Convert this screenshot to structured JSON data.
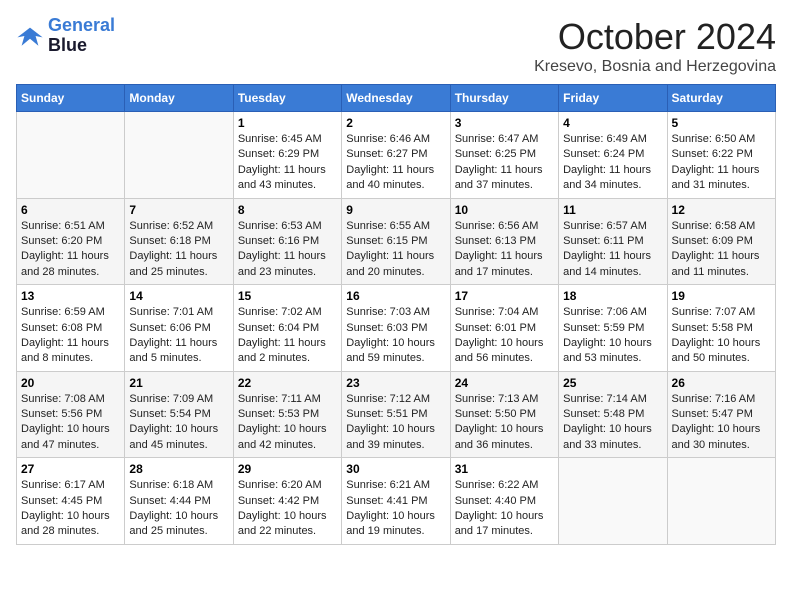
{
  "logo": {
    "line1": "General",
    "line2": "Blue"
  },
  "title": "October 2024",
  "location": "Kresevo, Bosnia and Herzegovina",
  "days_of_week": [
    "Sunday",
    "Monday",
    "Tuesday",
    "Wednesday",
    "Thursday",
    "Friday",
    "Saturday"
  ],
  "weeks": [
    [
      {
        "day": "",
        "info": ""
      },
      {
        "day": "",
        "info": ""
      },
      {
        "day": "1",
        "info": "Sunrise: 6:45 AM\nSunset: 6:29 PM\nDaylight: 11 hours and 43 minutes."
      },
      {
        "day": "2",
        "info": "Sunrise: 6:46 AM\nSunset: 6:27 PM\nDaylight: 11 hours and 40 minutes."
      },
      {
        "day": "3",
        "info": "Sunrise: 6:47 AM\nSunset: 6:25 PM\nDaylight: 11 hours and 37 minutes."
      },
      {
        "day": "4",
        "info": "Sunrise: 6:49 AM\nSunset: 6:24 PM\nDaylight: 11 hours and 34 minutes."
      },
      {
        "day": "5",
        "info": "Sunrise: 6:50 AM\nSunset: 6:22 PM\nDaylight: 11 hours and 31 minutes."
      }
    ],
    [
      {
        "day": "6",
        "info": "Sunrise: 6:51 AM\nSunset: 6:20 PM\nDaylight: 11 hours and 28 minutes."
      },
      {
        "day": "7",
        "info": "Sunrise: 6:52 AM\nSunset: 6:18 PM\nDaylight: 11 hours and 25 minutes."
      },
      {
        "day": "8",
        "info": "Sunrise: 6:53 AM\nSunset: 6:16 PM\nDaylight: 11 hours and 23 minutes."
      },
      {
        "day": "9",
        "info": "Sunrise: 6:55 AM\nSunset: 6:15 PM\nDaylight: 11 hours and 20 minutes."
      },
      {
        "day": "10",
        "info": "Sunrise: 6:56 AM\nSunset: 6:13 PM\nDaylight: 11 hours and 17 minutes."
      },
      {
        "day": "11",
        "info": "Sunrise: 6:57 AM\nSunset: 6:11 PM\nDaylight: 11 hours and 14 minutes."
      },
      {
        "day": "12",
        "info": "Sunrise: 6:58 AM\nSunset: 6:09 PM\nDaylight: 11 hours and 11 minutes."
      }
    ],
    [
      {
        "day": "13",
        "info": "Sunrise: 6:59 AM\nSunset: 6:08 PM\nDaylight: 11 hours and 8 minutes."
      },
      {
        "day": "14",
        "info": "Sunrise: 7:01 AM\nSunset: 6:06 PM\nDaylight: 11 hours and 5 minutes."
      },
      {
        "day": "15",
        "info": "Sunrise: 7:02 AM\nSunset: 6:04 PM\nDaylight: 11 hours and 2 minutes."
      },
      {
        "day": "16",
        "info": "Sunrise: 7:03 AM\nSunset: 6:03 PM\nDaylight: 10 hours and 59 minutes."
      },
      {
        "day": "17",
        "info": "Sunrise: 7:04 AM\nSunset: 6:01 PM\nDaylight: 10 hours and 56 minutes."
      },
      {
        "day": "18",
        "info": "Sunrise: 7:06 AM\nSunset: 5:59 PM\nDaylight: 10 hours and 53 minutes."
      },
      {
        "day": "19",
        "info": "Sunrise: 7:07 AM\nSunset: 5:58 PM\nDaylight: 10 hours and 50 minutes."
      }
    ],
    [
      {
        "day": "20",
        "info": "Sunrise: 7:08 AM\nSunset: 5:56 PM\nDaylight: 10 hours and 47 minutes."
      },
      {
        "day": "21",
        "info": "Sunrise: 7:09 AM\nSunset: 5:54 PM\nDaylight: 10 hours and 45 minutes."
      },
      {
        "day": "22",
        "info": "Sunrise: 7:11 AM\nSunset: 5:53 PM\nDaylight: 10 hours and 42 minutes."
      },
      {
        "day": "23",
        "info": "Sunrise: 7:12 AM\nSunset: 5:51 PM\nDaylight: 10 hours and 39 minutes."
      },
      {
        "day": "24",
        "info": "Sunrise: 7:13 AM\nSunset: 5:50 PM\nDaylight: 10 hours and 36 minutes."
      },
      {
        "day": "25",
        "info": "Sunrise: 7:14 AM\nSunset: 5:48 PM\nDaylight: 10 hours and 33 minutes."
      },
      {
        "day": "26",
        "info": "Sunrise: 7:16 AM\nSunset: 5:47 PM\nDaylight: 10 hours and 30 minutes."
      }
    ],
    [
      {
        "day": "27",
        "info": "Sunrise: 6:17 AM\nSunset: 4:45 PM\nDaylight: 10 hours and 28 minutes."
      },
      {
        "day": "28",
        "info": "Sunrise: 6:18 AM\nSunset: 4:44 PM\nDaylight: 10 hours and 25 minutes."
      },
      {
        "day": "29",
        "info": "Sunrise: 6:20 AM\nSunset: 4:42 PM\nDaylight: 10 hours and 22 minutes."
      },
      {
        "day": "30",
        "info": "Sunrise: 6:21 AM\nSunset: 4:41 PM\nDaylight: 10 hours and 19 minutes."
      },
      {
        "day": "31",
        "info": "Sunrise: 6:22 AM\nSunset: 4:40 PM\nDaylight: 10 hours and 17 minutes."
      },
      {
        "day": "",
        "info": ""
      },
      {
        "day": "",
        "info": ""
      }
    ]
  ]
}
